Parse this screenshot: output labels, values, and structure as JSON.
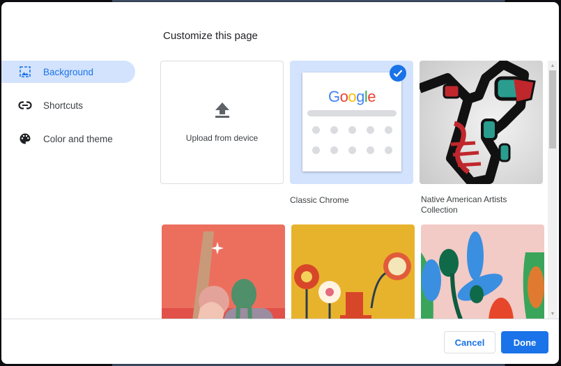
{
  "dialog": {
    "title": "Customize this page"
  },
  "sidebar": {
    "items": [
      {
        "label": "Background",
        "icon": "image-icon",
        "active": true
      },
      {
        "label": "Shortcuts",
        "icon": "link-icon",
        "active": false
      },
      {
        "label": "Color and theme",
        "icon": "palette-icon",
        "active": false
      }
    ]
  },
  "backgrounds": {
    "upload": {
      "label": "Upload from device",
      "icon": "upload-icon"
    },
    "tiles": [
      {
        "label": "Classic Chrome",
        "selected": true
      },
      {
        "label": "Native American Artists Collection",
        "selected": false
      },
      {
        "label": "",
        "selected": false
      },
      {
        "label": "",
        "selected": false
      },
      {
        "label": "",
        "selected": false
      }
    ],
    "google_logo": [
      "G",
      "o",
      "o",
      "g",
      "l",
      "e"
    ],
    "google_colors": [
      "#4285f4",
      "#ea4335",
      "#fbbc05",
      "#4285f4",
      "#34a853",
      "#ea4335"
    ]
  },
  "footer": {
    "cancel_label": "Cancel",
    "done_label": "Done"
  },
  "colors": {
    "accent": "#1a73e8",
    "selected_bg": "#d3e3fd"
  }
}
